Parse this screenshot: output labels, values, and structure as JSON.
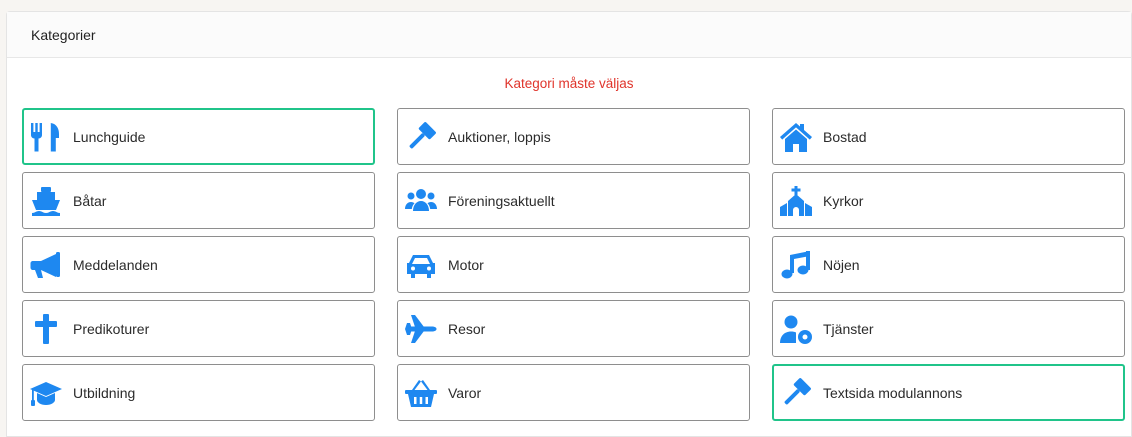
{
  "header": {
    "title": "Kategorier"
  },
  "error_message": "Kategori måste väljas",
  "colors": {
    "icon": "#1e88f0",
    "selected_border": "#20c48a",
    "error": "#e0342b"
  },
  "categories": [
    {
      "label": "Lunchguide",
      "icon": "utensils-icon",
      "selected": true
    },
    {
      "label": "Auktioner, loppis",
      "icon": "gavel-icon",
      "selected": false
    },
    {
      "label": "Bostad",
      "icon": "home-icon",
      "selected": false
    },
    {
      "label": "Båtar",
      "icon": "ship-icon",
      "selected": false
    },
    {
      "label": "Föreningsaktuellt",
      "icon": "users-icon",
      "selected": false
    },
    {
      "label": "Kyrkor",
      "icon": "church-icon",
      "selected": false
    },
    {
      "label": "Meddelanden",
      "icon": "bullhorn-icon",
      "selected": false
    },
    {
      "label": "Motor",
      "icon": "car-icon",
      "selected": false
    },
    {
      "label": "Nöjen",
      "icon": "music-icon",
      "selected": false
    },
    {
      "label": "Predikoturer",
      "icon": "cross-icon",
      "selected": false
    },
    {
      "label": "Resor",
      "icon": "plane-icon",
      "selected": false
    },
    {
      "label": "Tjänster",
      "icon": "user-cog-icon",
      "selected": false
    },
    {
      "label": "Utbildning",
      "icon": "graduation-cap-icon",
      "selected": false
    },
    {
      "label": "Varor",
      "icon": "shopping-basket-icon",
      "selected": false
    },
    {
      "label": "Textsida modulannons",
      "icon": "gavel-icon",
      "selected": true
    }
  ]
}
